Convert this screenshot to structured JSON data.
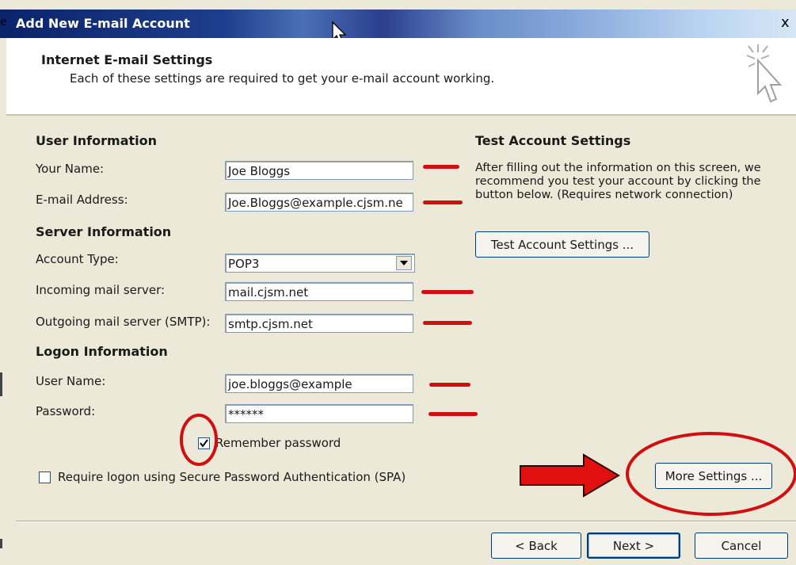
{
  "window": {
    "title": "Add New E-mail Account",
    "title_left_fragment": "e",
    "close_glyph": "x"
  },
  "header": {
    "title": "Internet E-mail Settings",
    "subtitle": "Each of these settings are required to get your e-mail account working."
  },
  "user_info": {
    "heading": "User Information",
    "name_label": "Your Name:",
    "name_value": "Joe Bloggs",
    "email_label": "E-mail Address:",
    "email_value": "Joe.Bloggs@example.cjsm.ne"
  },
  "server_info": {
    "heading": "Server Information",
    "account_type_label": "Account Type:",
    "account_type_value": "POP3",
    "incoming_label": "Incoming mail server:",
    "incoming_value": "mail.cjsm.net",
    "outgoing_label": "Outgoing mail server (SMTP):",
    "outgoing_value": "smtp.cjsm.net"
  },
  "logon_info": {
    "heading": "Logon Information",
    "username_label": "User Name:",
    "username_value": "joe.bloggs@example",
    "password_label": "Password:",
    "password_value": "******",
    "remember_label": "Remember password",
    "remember_checked": true,
    "spa_label": "Require logon using Secure Password Authentication (SPA)",
    "spa_checked": false
  },
  "test_settings": {
    "heading": "Test Account Settings",
    "description": "After filling out the information on this screen, we recommend you test your account by clicking the button below. (Requires network connection)",
    "button_label": "Test Account Settings ..."
  },
  "buttons": {
    "more_settings": "More Settings ...",
    "back": "< Back",
    "next": "Next >",
    "cancel": "Cancel"
  },
  "annotation_color": "#d01010"
}
